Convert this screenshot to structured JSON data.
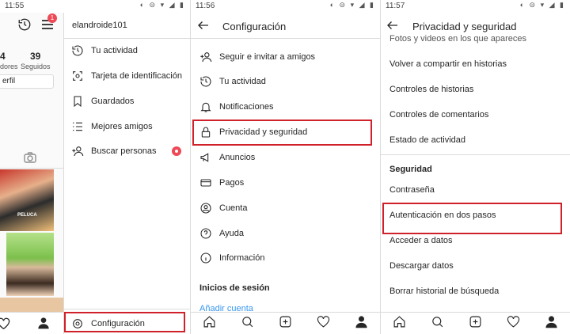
{
  "panel1": {
    "time": "11:55",
    "notification_count": "1",
    "stats": [
      {
        "value": "4",
        "label": "dores"
      },
      {
        "value": "39",
        "label": "Seguidos"
      }
    ],
    "edit_profile_label": "erfil",
    "username": "elandroide101",
    "menu": [
      {
        "label": "Tu actividad",
        "icon": "activity-icon"
      },
      {
        "label": "Tarjeta de identificación",
        "icon": "nametag-icon"
      },
      {
        "label": "Guardados",
        "icon": "bookmark-icon"
      },
      {
        "label": "Mejores amigos",
        "icon": "close-friends-icon"
      },
      {
        "label": "Buscar personas",
        "icon": "add-person-icon"
      }
    ],
    "settings_label": "Configuración",
    "thumb_caption": "PELUCA"
  },
  "panel2": {
    "time": "11:56",
    "title": "Configuración",
    "items": [
      {
        "label": "Seguir e invitar a amigos",
        "icon": "add-person-icon"
      },
      {
        "label": "Tu actividad",
        "icon": "activity-icon"
      },
      {
        "label": "Notificaciones",
        "icon": "bell-icon"
      },
      {
        "label": "Privacidad y seguridad",
        "icon": "lock-icon"
      },
      {
        "label": "Anuncios",
        "icon": "megaphone-icon"
      },
      {
        "label": "Pagos",
        "icon": "card-icon"
      },
      {
        "label": "Cuenta",
        "icon": "account-icon"
      },
      {
        "label": "Ayuda",
        "icon": "help-icon"
      },
      {
        "label": "Información",
        "icon": "info-icon"
      }
    ],
    "logins_header": "Inicios de sesión",
    "add_account": "Añadir cuenta"
  },
  "panel3": {
    "time": "11:57",
    "title": "Privacidad y seguridad",
    "items_top": [
      "Fotos y videos en los que apareces",
      "Volver a compartir en historias",
      "Controles de historias",
      "Controles de comentarios",
      "Estado de actividad"
    ],
    "security_header": "Seguridad",
    "items_security": [
      "Contraseña",
      "Autenticación en dos pasos",
      "Acceder a datos",
      "Descargar datos",
      "Borrar historial de búsqueda"
    ]
  },
  "colors": {
    "highlight": "#d0202a",
    "badge": "#ed4956",
    "link": "#3897f0"
  }
}
